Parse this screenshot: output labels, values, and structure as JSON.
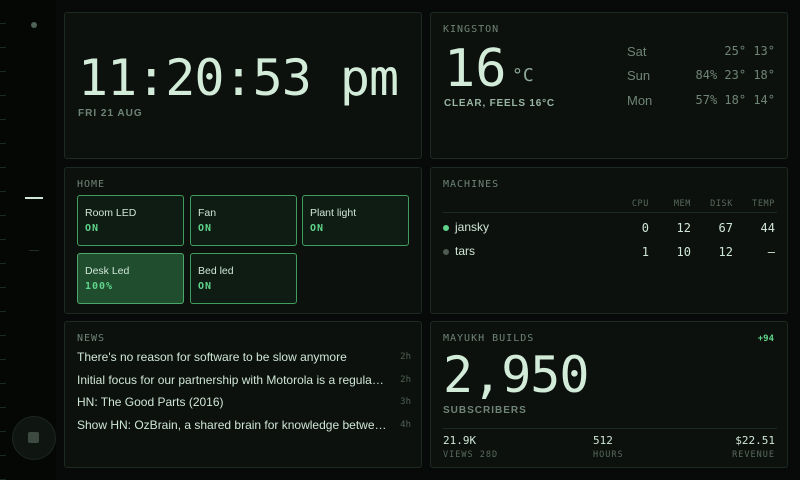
{
  "clock": {
    "time": "11:20:53 pm",
    "date": "FRI 21 AUG"
  },
  "weather": {
    "title": "KINGSTON",
    "temp": "16",
    "unit": "°C",
    "condition": "CLEAR, FEELS 16°C",
    "forecast": [
      {
        "day": "Sat",
        "values": "25° 13°"
      },
      {
        "day": "Sun",
        "values": "84% 23° 18°"
      },
      {
        "day": "Mon",
        "values": "57% 18° 14°"
      }
    ]
  },
  "home": {
    "title": "HOME",
    "tiles": [
      {
        "name": "Room LED",
        "state": "ON"
      },
      {
        "name": "Fan",
        "state": "ON"
      },
      {
        "name": "Plant light",
        "state": "ON"
      },
      {
        "name": "Desk Led",
        "state": "100%"
      },
      {
        "name": "Bed led",
        "state": "ON"
      }
    ]
  },
  "machines": {
    "title": "MACHINES",
    "headers": [
      "CPU",
      "MEM",
      "DISK",
      "TEMP"
    ],
    "rows": [
      {
        "name": "jansky",
        "cpu": "0",
        "mem": "12",
        "disk": "67",
        "temp": "44",
        "status_color": "#5fd48a"
      },
      {
        "name": "tars",
        "cpu": "1",
        "mem": "10",
        "disk": "12",
        "temp": "—",
        "status_color": "#4e5a52"
      }
    ]
  },
  "news": {
    "title": "NEWS",
    "items": [
      {
        "title": "There's no reason for software to be slow anymore",
        "age": "2h"
      },
      {
        "title": "Initial focus for our partnership with Motorola is a regular non-developer phone",
        "age": "2h"
      },
      {
        "title": "HN: The Good Parts (2016)",
        "age": "3h"
      },
      {
        "title": "Show HN: OzBrain, a shared brain for knowledge between agents",
        "age": "4h"
      }
    ]
  },
  "subscribers": {
    "title": "MAYUKH BUILDS",
    "delta": "+94",
    "count": "2,950",
    "label": "SUBSCRIBERS",
    "stats": [
      {
        "value": "21.9K",
        "label": "VIEWS 28D"
      },
      {
        "value": "512",
        "label": "HOURS"
      },
      {
        "value": "$22.51",
        "label": "REVENUE"
      }
    ]
  },
  "colors": {
    "accent": "#5fd48a",
    "background": "#070a08",
    "panel": "#0c110d",
    "tile_active": "#1f4d2e"
  },
  "icons": {
    "rail_top": "status-dot-icon",
    "rail_mid": "menu-dash-icon",
    "rail_bottom": "avatar-icon"
  }
}
